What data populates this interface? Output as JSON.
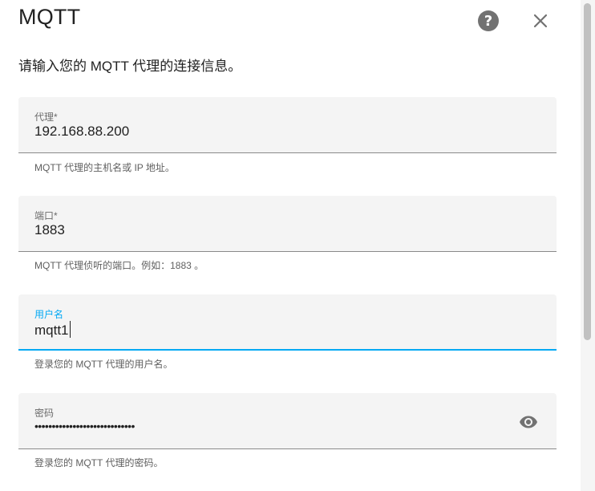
{
  "dialog": {
    "title": "MQTT",
    "description": "请输入您的 MQTT 代理的连接信息。",
    "help_icon": "help-circle-icon",
    "close_icon": "close-icon"
  },
  "fields": {
    "broker": {
      "label": "代理*",
      "value": "192.168.88.200",
      "helper": "MQTT 代理的主机名或 IP 地址。"
    },
    "port": {
      "label": "端口*",
      "value": "1883",
      "helper": "MQTT 代理侦听的端口。例如：1883 。"
    },
    "username": {
      "label": "用户名",
      "value": "mqtt1",
      "helper": "登录您的 MQTT 代理的用户名。"
    },
    "password": {
      "label": "密码",
      "value": "•••••••••••••••••••••••••••••",
      "helper": "登录您的 MQTT 代理的密码。",
      "toggle_icon": "eye-icon"
    }
  },
  "colors": {
    "accent": "#03a9f4",
    "field_bg": "#f4f4f4",
    "icon": "#727272"
  }
}
